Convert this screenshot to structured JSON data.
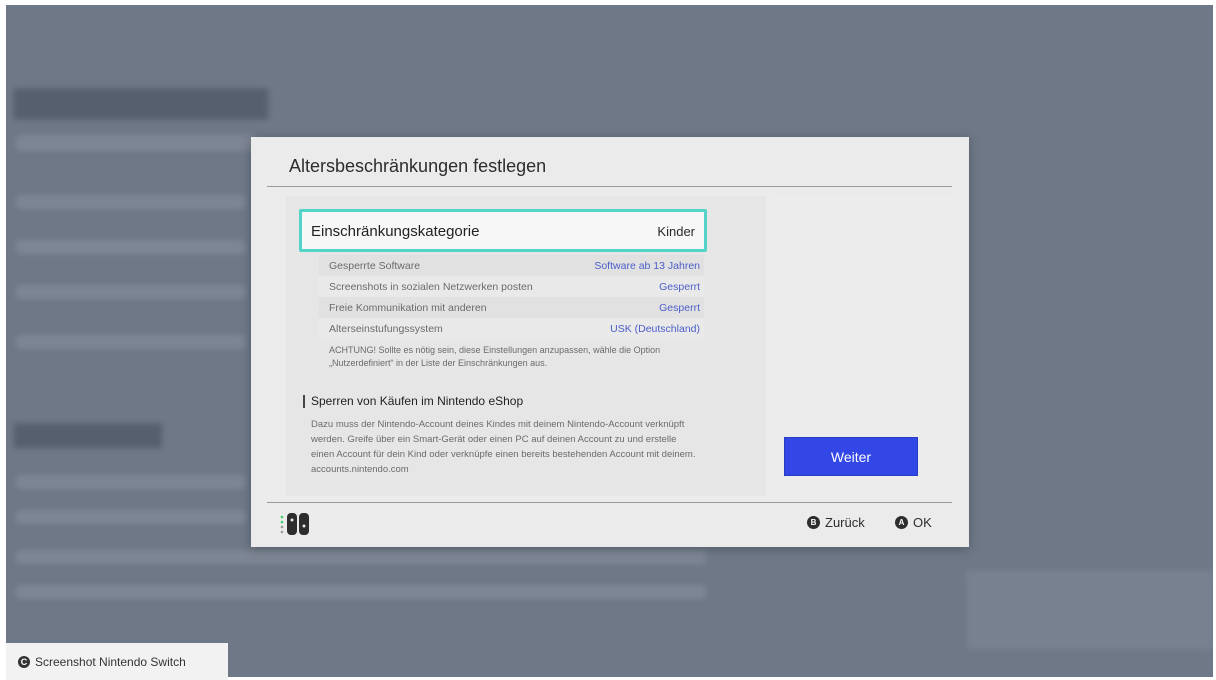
{
  "dialog": {
    "title": "Altersbeschränkungen festlegen",
    "category": {
      "label": "Einschränkungskategorie",
      "value": "Kinder"
    },
    "details": [
      {
        "label": "Gesperrte Software",
        "value": "Software ab 13 Jahren"
      },
      {
        "label": "Screenshots in sozialen Netzwerken posten",
        "value": "Gesperrt"
      },
      {
        "label": "Freie Kommunikation mit anderen",
        "value": "Gesperrt"
      },
      {
        "label": "Alterseinstufungssystem",
        "value": "USK (Deutschland)"
      }
    ],
    "note": "ACHTUNG! Sollte es nötig sein, diese Einstellungen anzupassen, wähle die Option „Nutzerdefiniert“ in der Liste der Einschränkungen aus.",
    "eshop": {
      "title": "Sperren von Käufen im Nintendo eShop",
      "body": "Dazu muss der Nintendo-Account deines Kindes mit deinem Nintendo-Account verknüpft werden. Greife über ein Smart-Gerät oder einen PC auf deinen Account zu und erstelle einen Account für dein Kind oder verknüpfe einen bereits bestehenden Account mit deinem. accounts.nintendo.com"
    },
    "primary_button": "Weiter",
    "footer": {
      "back": {
        "key": "B",
        "label": "Zurück"
      },
      "ok": {
        "key": "A",
        "label": "OK"
      }
    }
  },
  "caption": {
    "icon": "C",
    "text": "Screenshot Nintendo Switch"
  },
  "colors": {
    "accent_highlight": "#54d4c9",
    "primary_button": "#3346e6",
    "link_value": "#4b5ec9",
    "backdrop": "#6e7887"
  },
  "icons": [
    "joycon-controller-icon",
    "b-button-icon",
    "a-button-icon",
    "copyright-icon"
  ]
}
